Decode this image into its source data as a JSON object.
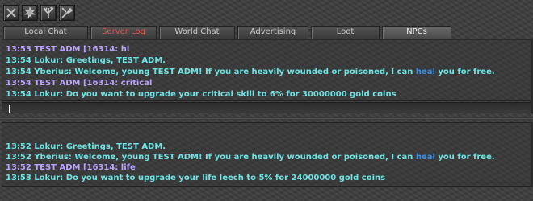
{
  "toolbar": {
    "icons": [
      "close-icon",
      "burst-icon",
      "tree-icon",
      "tools-icon"
    ]
  },
  "tabs": [
    {
      "label": "Local Chat",
      "state": "normal"
    },
    {
      "label": "Server Log",
      "state": "highlight"
    },
    {
      "label": "World Chat",
      "state": "normal"
    },
    {
      "label": "Advertising",
      "state": "normal"
    },
    {
      "label": "Loot",
      "state": "normal"
    },
    {
      "label": "NPCs",
      "state": "active"
    }
  ],
  "colors": {
    "npc_text": "#6fe3e3",
    "player_text": "#b9a3ff",
    "keyword_link": "#3a8fe8",
    "server_tab": "#e05050"
  },
  "top_panel": {
    "lines": [
      {
        "segments": [
          {
            "text": "13:53 TEST ADM [16314: hi",
            "color": "purple"
          }
        ]
      },
      {
        "segments": [
          {
            "text": "13:54 Lokur: Greetings, TEST ADM.",
            "color": "cyan"
          }
        ]
      },
      {
        "segments": [
          {
            "text": "13:54 Yberius: Welcome, young TEST ADM! If you are heavily wounded or poisoned, I can ",
            "color": "cyan"
          },
          {
            "text": "heal",
            "color": "blue"
          },
          {
            "text": " you for free.",
            "color": "cyan"
          }
        ]
      },
      {
        "segments": [
          {
            "text": "13:54 TEST ADM [16314: critical",
            "color": "purple"
          }
        ]
      },
      {
        "segments": [
          {
            "text": "13:54 Lokur: Do you want to upgrade your critical skill to 6% for 30000000 gold coins",
            "color": "cyan"
          }
        ]
      }
    ]
  },
  "input": {
    "value": ""
  },
  "bottom_panel": {
    "lines": [
      {
        "segments": [
          {
            "text": "13:52 Lokur: Greetings, TEST ADM.",
            "color": "cyan"
          }
        ]
      },
      {
        "segments": [
          {
            "text": "13:52 Yberius: Welcome, young TEST ADM! If you are heavily wounded or poisoned, I can ",
            "color": "cyan"
          },
          {
            "text": "heal",
            "color": "blue"
          },
          {
            "text": " you for free.",
            "color": "cyan"
          }
        ]
      },
      {
        "segments": [
          {
            "text": "13:52 TEST ADM [16314: life",
            "color": "purple"
          }
        ]
      },
      {
        "segments": [
          {
            "text": "13:53 Lokur: Do you want to upgrade your life leech to 5% for 24000000 gold coins",
            "color": "cyan"
          }
        ]
      }
    ]
  }
}
